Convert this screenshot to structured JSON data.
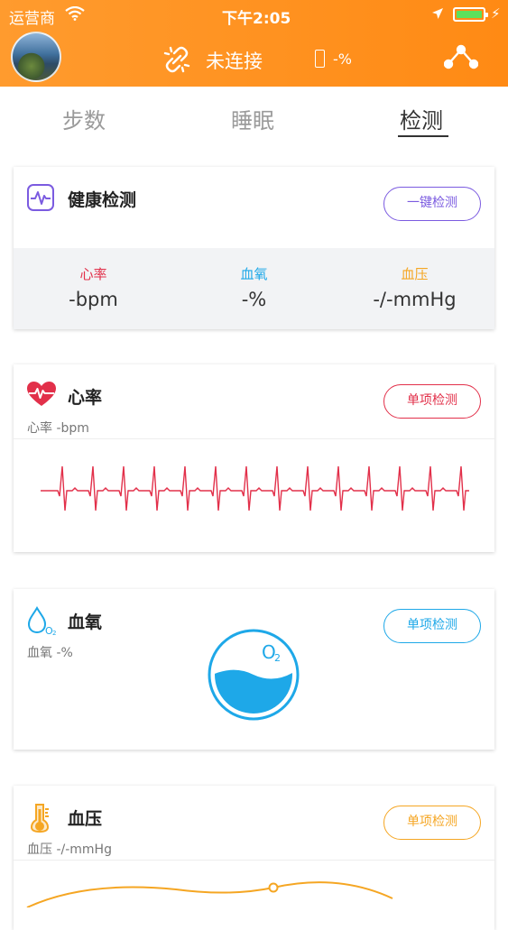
{
  "status_bar": {
    "carrier": "运营商",
    "time": "下午2:05"
  },
  "header": {
    "connection_status": "未连接",
    "battery_percent": "-%"
  },
  "tabs": [
    {
      "label": "步数",
      "active": false
    },
    {
      "label": "睡眠",
      "active": false
    },
    {
      "label": "检测",
      "active": true
    }
  ],
  "health_check": {
    "title": "健康检测",
    "button": "一键检测",
    "metrics": [
      {
        "label": "心率",
        "value": "-bpm",
        "color": "#E2304A"
      },
      {
        "label": "血氧",
        "value": "-%",
        "color": "#1EA8E8"
      },
      {
        "label": "血压",
        "value": "-/-mmHg",
        "color": "#F5A623"
      }
    ]
  },
  "heart_rate": {
    "title": "心率",
    "subtitle": "心率 -bpm",
    "button": "单项检测",
    "color": "#E2304A"
  },
  "blood_oxygen": {
    "title": "血氧",
    "subtitle": "血氧 -%",
    "button": "单项检测",
    "gauge_label": "O",
    "gauge_sub": "2",
    "color": "#1EA8E8"
  },
  "blood_pressure": {
    "title": "血压",
    "subtitle": "血压 -/-mmHg",
    "button": "单项检测",
    "color": "#F5A623"
  },
  "colors": {
    "header_orange": "#FF8A14",
    "purple": "#7B5BE0"
  }
}
